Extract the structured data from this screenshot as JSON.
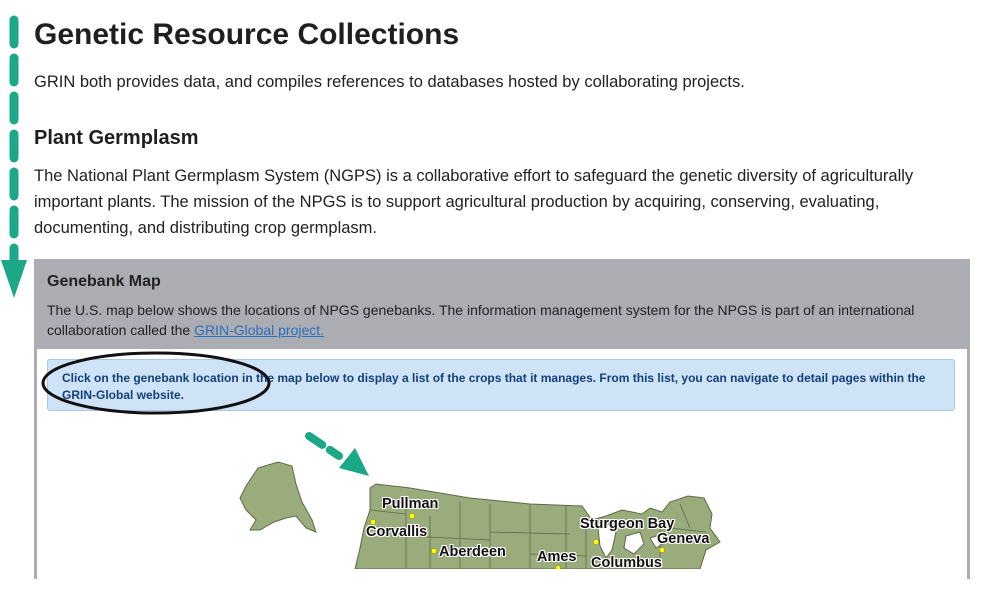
{
  "header": {
    "title": "Genetic Resource Collections",
    "intro": "GRIN both provides data, and compiles references to databases hosted by collaborating projects."
  },
  "section": {
    "title": "Plant Germplasm",
    "description": "The National Plant Germplasm System (NGPS) is a collaborative effort to safeguard the genetic diversity of agriculturally important plants. The mission of the NPGS is to support agricultural production by acquiring, conserving, evaluating, documenting, and distributing crop germplasm."
  },
  "panel": {
    "title": "Genebank Map",
    "description_prefix": "The U.S. map below shows the locations of NPGS genebanks. The information management system for the NPGS is part of an international collaboration called the ",
    "link_text": "GRIN-Global project.",
    "notice": "Click on the genebank location in the map below to display a list of the crops that it manages. From this list, you can navigate to detail pages within the GRIN-Global website."
  },
  "map": {
    "labels": [
      "Pullman",
      "Corvallis",
      "Aberdeen",
      "Ames",
      "Sturgeon Bay",
      "Geneva",
      "Columbus"
    ]
  },
  "colors": {
    "map_fill": "#9aab7c",
    "annotation_arrow": "#1aa886",
    "panel_bg": "#acadb2",
    "notice_bg": "#cfe3f7",
    "marker": "#ffff00"
  }
}
